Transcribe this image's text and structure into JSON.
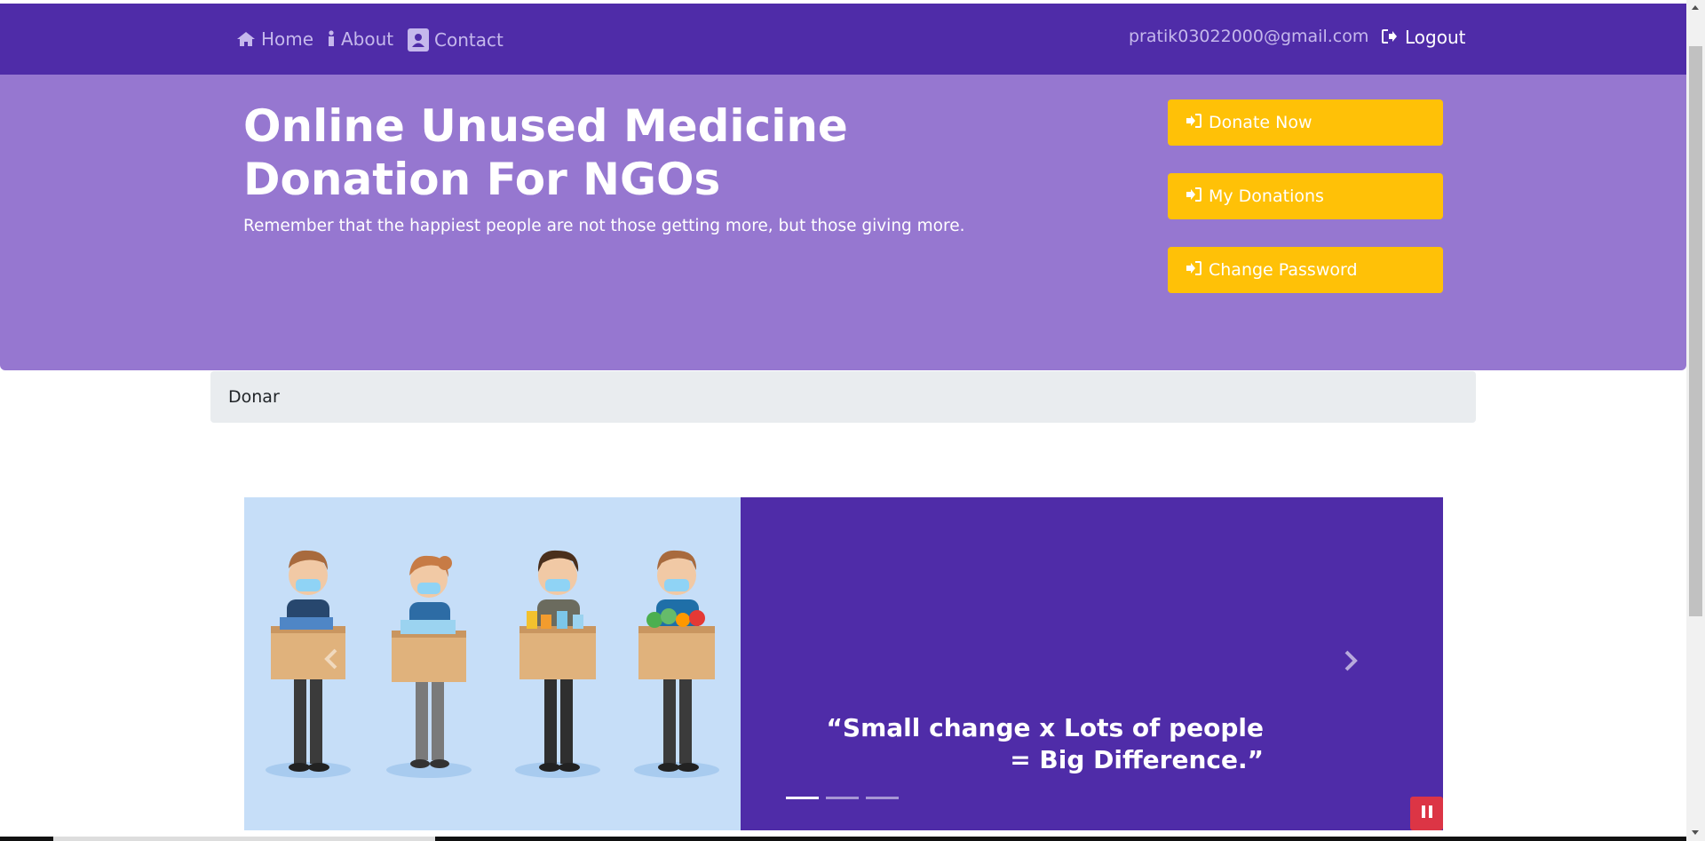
{
  "nav": {
    "home_label": "Home",
    "about_label": "About",
    "contact_label": "Contact",
    "user_email": "pratik03022000@gmail.com",
    "logout_label": "Logout"
  },
  "hero": {
    "title": "Online Unused Medicine Donation For NGOs",
    "subtitle": "Remember that the happiest people are not those getting more, but those giving more.",
    "buttons": [
      {
        "label": "Donate Now",
        "icon": "sign-in-icon"
      },
      {
        "label": "My Donations",
        "icon": "sign-in-icon"
      },
      {
        "label": "Change Password",
        "icon": "sign-in-icon"
      }
    ]
  },
  "breadcrumb": {
    "current": "Donar"
  },
  "carousel": {
    "quote": "“Small change x Lots of people = Big Difference.”",
    "slide_count": 3,
    "active_slide": 1,
    "image_subject": "four volunteers in masks holding donation boxes"
  },
  "colors": {
    "navbar": "#4f2ca8",
    "hero": "#9677d0",
    "button": "#ffc107",
    "pause": "#dc3545",
    "breadcrumb": "#e9ecef"
  }
}
